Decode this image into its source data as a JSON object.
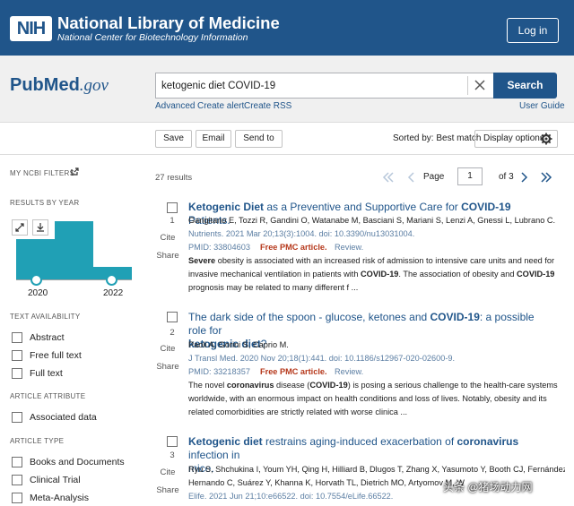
{
  "header": {
    "nih_logo": "NIH",
    "title": "National Library of Medicine",
    "subtitle": "National Center for Biotechnology Information",
    "login_label": "Log in"
  },
  "search": {
    "logo_pub": "Pub",
    "logo_med": "Med",
    "logo_gov": ".gov",
    "query": "ketogenic diet COVID-19",
    "button_label": "Search",
    "links": {
      "advanced": "Advanced",
      "create_alert": "Create alert",
      "create_rss": "Create RSS",
      "user_guide": "User Guide"
    }
  },
  "actions": {
    "save": "Save",
    "email": "Email",
    "send_to": "Send to",
    "sorted_by": "Sorted by: Best match",
    "display_options": "Display options"
  },
  "sidebar": {
    "my_filters": "MY NCBI FILTERS",
    "results_by_year": "RESULTS BY YEAR",
    "year_start": "2020",
    "year_end": "2022",
    "year_counts": [
      {
        "year": "2020",
        "value": 10
      },
      {
        "year": "2021",
        "value": 15
      },
      {
        "year": "2022",
        "value": 3
      }
    ],
    "text_availability": "TEXT AVAILABILITY",
    "text_filters": [
      "Abstract",
      "Free full text",
      "Full text"
    ],
    "article_attribute": "ARTICLE ATTRIBUTE",
    "attribute_filters": [
      "Associated data"
    ],
    "article_type": "ARTICLE TYPE",
    "type_filters": [
      "Books and Documents",
      "Clinical Trial",
      "Meta-Analysis"
    ]
  },
  "results": {
    "count": "27 results",
    "page_label": "Page",
    "page_value": "1",
    "of_label": "of 3",
    "cite_label": "Cite",
    "share_label": "Share",
    "free_label": "Free PMC article.",
    "review_label": "Review.",
    "articles": [
      {
        "num": "1",
        "title_a": "Ketogenic Diet",
        "title_b": " as a Preventive and Supportive Care for ",
        "title_c": "COVID-19",
        "title_d": " Patients.",
        "authors": "Gangitano E, Tozzi R, Gandini O, Watanabe M, Basciani S, Mariani S, Lenzi A, Gnessi L, Lubrano C.",
        "citation": "Nutrients. 2021 Mar 20;13(3):1004. doi: 10.3390/nu13031004.",
        "pmid": "PMID: 33804603",
        "snippet_1a": "Severe",
        "snippet_1b": " obesity is associated with an increased risk of admission to intensive care units and need for",
        "snippet_2a": "invasive mechanical ventilation in patients with ",
        "snippet_2b": "COVID-19",
        "snippet_2c": ". The association of obesity and ",
        "snippet_2d": "COVID-19",
        "snippet_3": "prognosis may be related to many different f ..."
      },
      {
        "num": "2",
        "title_a": "The dark side of the spoon - glucose, ketones and ",
        "title_b": "COVID-19",
        "title_c": ": a possible role for",
        "title_d": "ketogenic diet",
        "title_e": "?",
        "authors": "Paoli A, Gorini S, Caprio M.",
        "citation": "J Transl Med. 2020 Nov 20;18(1):441. doi: 10.1186/s12967-020-02600-9.",
        "pmid": "PMID: 33218357",
        "snippet_1a": "The novel ",
        "snippet_1b": "coronavirus",
        "snippet_1c": " disease (",
        "snippet_1d": "COVID-19",
        "snippet_1e": ") is posing a serious challenge to the health-care systems",
        "snippet_2": "worldwide, with an enormous impact on health conditions and loss of lives. Notably, obesity and its",
        "snippet_3": "related comorbidities are strictly related with worse clinica ..."
      },
      {
        "num": "3",
        "title_a": "Ketogenic diet",
        "title_b": " restrains aging-induced exacerbation of ",
        "title_c": "coronavirus",
        "title_d": " infection in",
        "title_e": "mice.",
        "authors_1": "Ryu S, Shchukina I, Youm YH, Qing H, Hilliard B, Dlugos T, Zhang X, Yasumoto Y, Booth CJ, Fernández-",
        "authors_2": "Hernando C, Suárez Y, Khanna K, Horvath TL, Dietrich MO, Artyomov M, W",
        "citation": "Elife. 2021 Jun 21;10:e66522. doi: 10.7554/eLife.66522."
      }
    ]
  },
  "watermark": "头条 @猪场动力网"
}
